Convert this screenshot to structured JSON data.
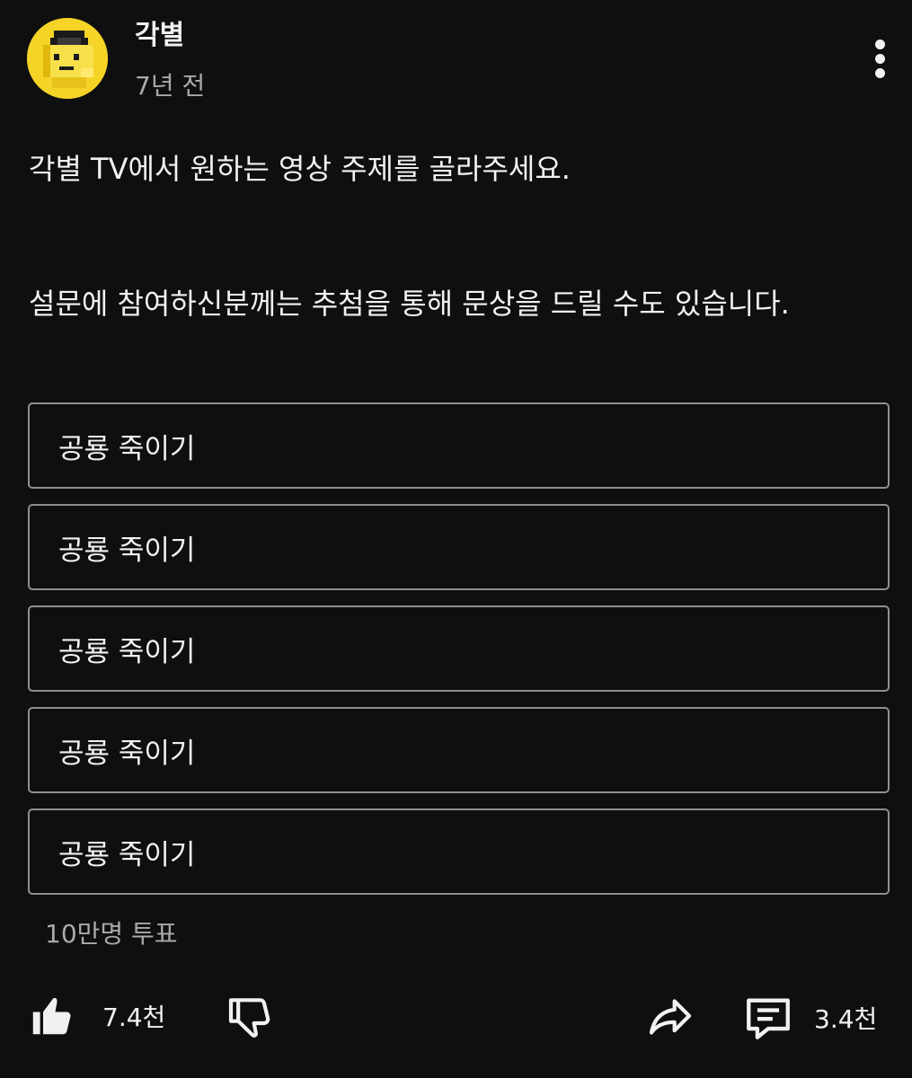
{
  "post": {
    "channel_name": "각별",
    "time_ago": "7년 전",
    "text_line1": "각별 TV에서 원하는 영상 주제를 골라주세요.",
    "text_line2": "설문에 참여하신분께는 추첨을 통해 문상을 드릴 수도 있습니다."
  },
  "poll": {
    "options": [
      {
        "label": "공룡 죽이기"
      },
      {
        "label": "공룡 죽이기"
      },
      {
        "label": "공룡 죽이기"
      },
      {
        "label": "공룡 죽이기"
      },
      {
        "label": "공룡 죽이기"
      }
    ],
    "vote_count": "10만명 투표"
  },
  "actions": {
    "like_count": "7.4천",
    "comment_count": "3.4천"
  },
  "icons": {
    "avatar": "pixel-character-avatar",
    "more": "more-vert-icon",
    "like": "thumbs-up-icon",
    "dislike": "thumbs-down-icon",
    "share": "share-arrow-icon",
    "comment": "comment-icon"
  },
  "colors": {
    "background": "#0f0f0f",
    "text": "#f1f1f1",
    "secondary_text": "#aaaaaa",
    "option_border": "#8f8f8f",
    "avatar_yellow": "#f5d327"
  }
}
